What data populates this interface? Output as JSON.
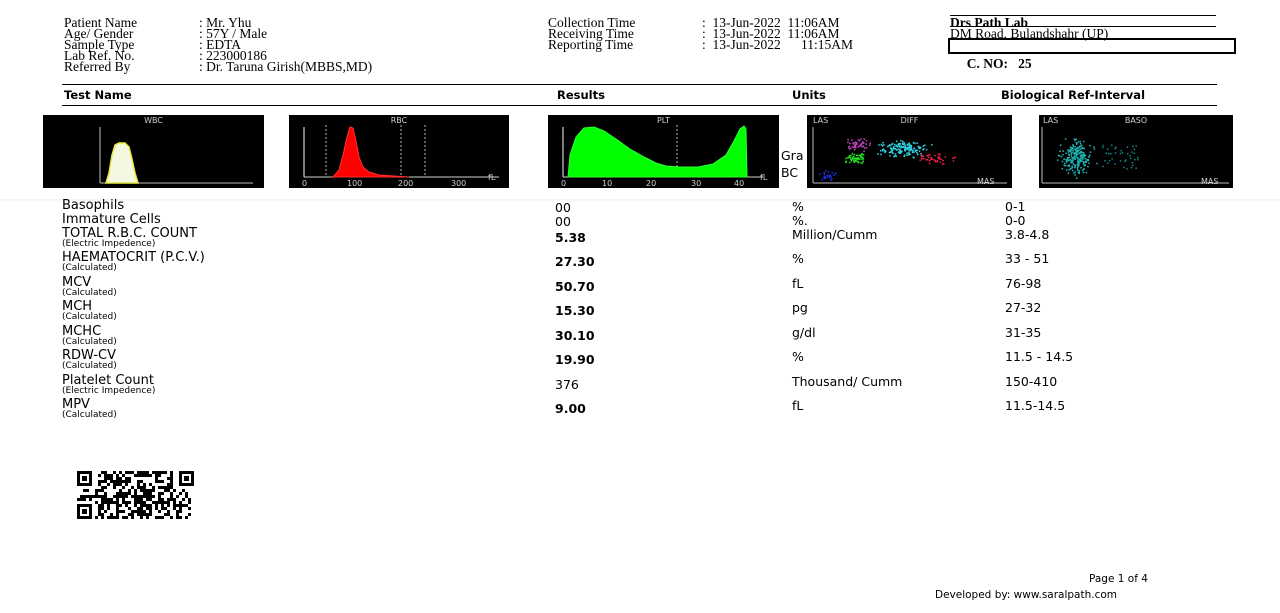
{
  "patient": {
    "name_label": "Patient Name",
    "name_value": ": Mr. Yhu",
    "age_label": "Age/ Gender",
    "age_value": ": 57Y / Male",
    "sample_label": "Sample Type",
    "sample_value": ": EDTA",
    "labref_label": "Lab Ref. No.",
    "labref_value": ": 223000186",
    "referred_label": "Referred By",
    "referred_value": ": Dr. Taruna Girish(MBBS,MD)"
  },
  "times": {
    "collection_label": "Collection Time",
    "collection_value": ":  13-Jun-2022  11:06AM",
    "receiving_label": "Receiving Time",
    "receiving_value": ":  13-Jun-2022  11:06AM",
    "reporting_label": "Reporting Time",
    "reporting_value": ":  13-Jun-2022      11:15AM"
  },
  "lab": {
    "name": "Drs Path Lab",
    "address": "DM Road, Bulandshahr (UP)",
    "cno": "C. NO:   25"
  },
  "columns": {
    "test": "Test Name",
    "results": "Results",
    "units": "Units",
    "ref": "Biological Ref-Interval"
  },
  "graphs": {
    "wbc": "WBC",
    "rbc": "RBC",
    "plt": "PLT",
    "diff": "DIFF",
    "baso": "BASO",
    "las": "LAS",
    "mas": "MAS",
    "fl": "fL",
    "rbc_ticks": [
      "0",
      "100",
      "200",
      "300"
    ],
    "plt_ticks": [
      "0",
      "10",
      "20",
      "30",
      "40"
    ],
    "peek1": "Gra",
    "peek2": "BC"
  },
  "rows": [
    {
      "name": "Basophils",
      "method": "",
      "result": "00",
      "bold": false,
      "unit": "%",
      "ref": "0-1"
    },
    {
      "name": "Immature Cells",
      "method": "",
      "result": "00",
      "bold": false,
      "unit": "%.",
      "ref": "0-0"
    },
    {
      "name": "TOTAL R.B.C. COUNT",
      "method": "(Electric Impedence)",
      "result": "5.38",
      "bold": true,
      "unit": "Million/Cumm",
      "ref": "3.8-4.8"
    },
    {
      "name": "HAEMATOCRIT (P.C.V.)",
      "method": "(Calculated)",
      "result": "27.30",
      "bold": true,
      "unit": "%",
      "ref": "33 - 51"
    },
    {
      "name": "MCV",
      "method": "(Calculated)",
      "result": "50.70",
      "bold": true,
      "unit": "fL",
      "ref": "76-98"
    },
    {
      "name": "MCH",
      "method": "(Calculated)",
      "result": "15.30",
      "bold": true,
      "unit": "pg",
      "ref": "27-32"
    },
    {
      "name": "MCHC",
      "method": "(Calculated)",
      "result": "30.10",
      "bold": true,
      "unit": "g/dl",
      "ref": "31-35"
    },
    {
      "name": "RDW-CV",
      "method": "(Calculated)",
      "result": "19.90",
      "bold": true,
      "unit": "%",
      "ref": "11.5 - 14.5"
    },
    {
      "name": "Platelet Count",
      "method": "(Electric Impedence)",
      "result": "376",
      "bold": false,
      "unit": "Thousand/ Cumm",
      "ref": "150-410"
    },
    {
      "name": "MPV",
      "method": "(Calculated)",
      "result": "9.00",
      "bold": true,
      "unit": "fL",
      "ref": "11.5-14.5"
    }
  ],
  "footer": {
    "page": "Page 1 of 4",
    "developed": "Developed by: www.saralpath.com"
  },
  "colors": {
    "rbc_fill": "#ff0000",
    "plt_fill": "#00ff00",
    "wbc_fill": "#f4f8e0",
    "wbc_line": "#e8e840",
    "diff_cyan": "#30d0e0",
    "diff_green": "#20e020",
    "diff_magenta": "#c040c0",
    "diff_red": "#e02040",
    "diff_blue": "#2030e0",
    "baso_cyan": "#20b0b0"
  }
}
